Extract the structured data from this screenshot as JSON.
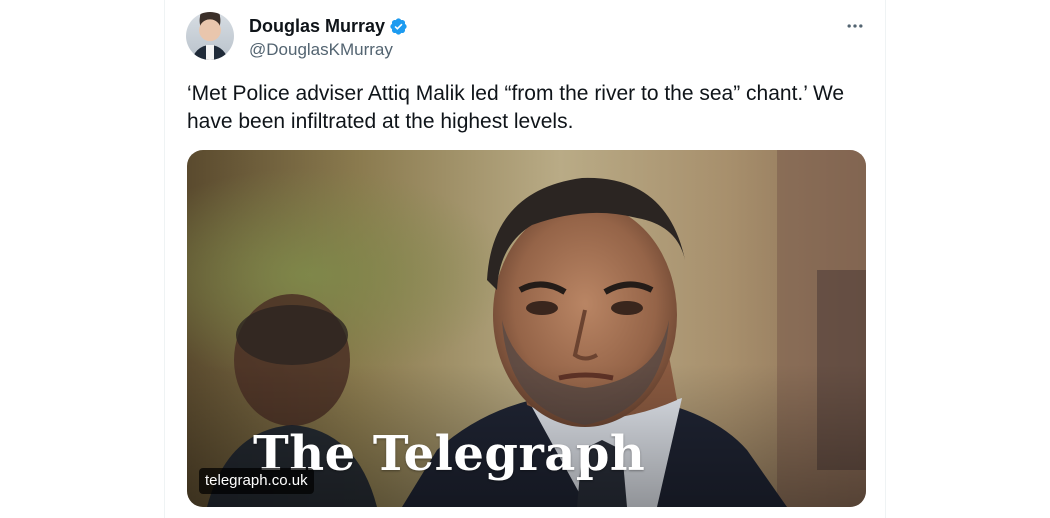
{
  "tweet": {
    "author": {
      "display_name": "Douglas Murray",
      "handle": "@DouglasKMurray",
      "verified": true,
      "avatar_icon": "avatar-photo"
    },
    "text": "‘Met Police adviser Attiq Malik led “from the river to the sea” chant.’ We have been infiltrated at the highest levels.",
    "more_icon": "more-horizontal-icon",
    "link_card": {
      "masthead": "The Telegraph",
      "domain": "telegraph.co.uk"
    }
  },
  "colors": {
    "text_primary": "#0f1419",
    "text_secondary": "#536471",
    "verified_blue": "#1d9bf0",
    "border": "#eff3f4"
  }
}
